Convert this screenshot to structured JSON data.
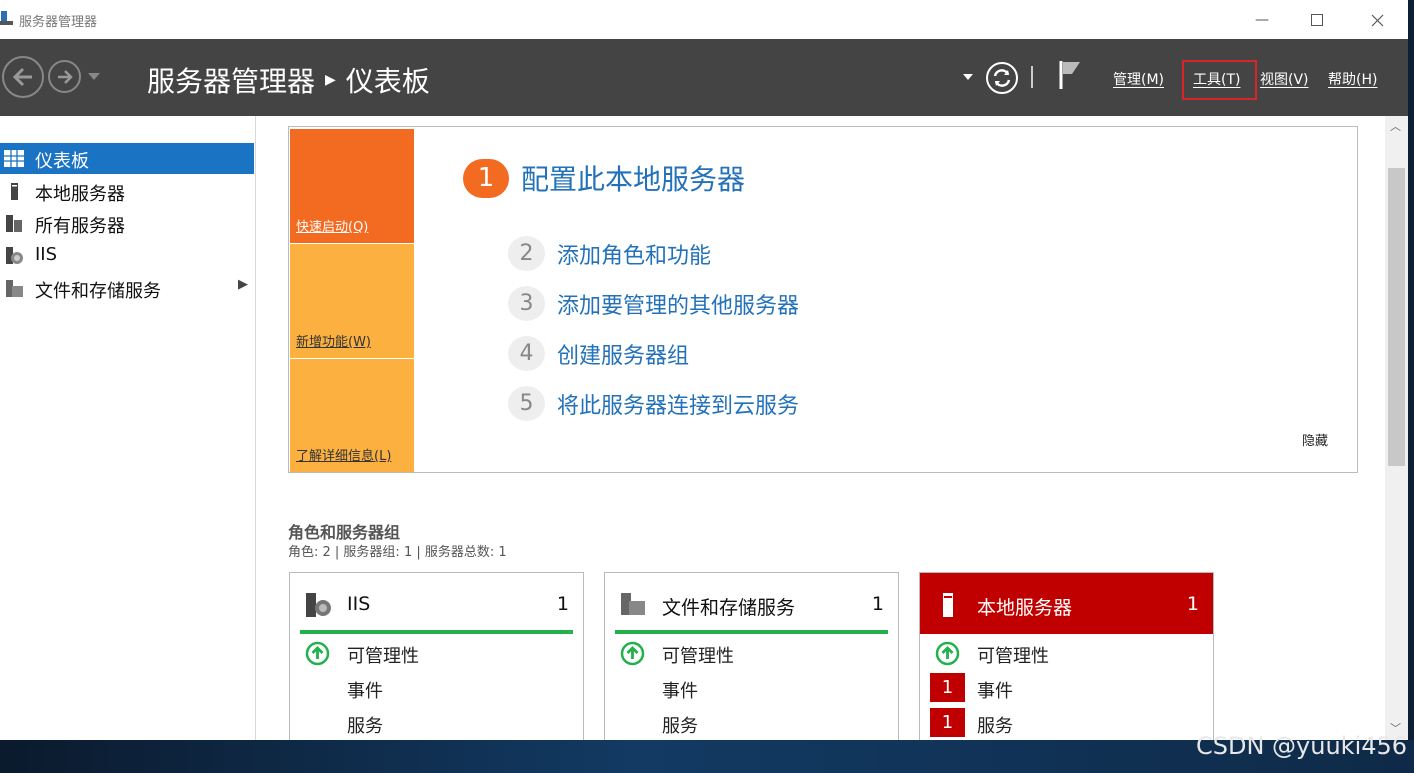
{
  "window": {
    "title": "服务器管理器"
  },
  "header": {
    "breadcrumb_app": "服务器管理器",
    "breadcrumb_page": "仪表板",
    "menus": [
      "管理(M)",
      "工具(T)",
      "视图(V)",
      "帮助(H)"
    ]
  },
  "sidebar": {
    "items": [
      {
        "label": "仪表板",
        "icon": "dashboard-icon",
        "active": true
      },
      {
        "label": "本地服务器",
        "icon": "server-icon"
      },
      {
        "label": "所有服务器",
        "icon": "servers-icon"
      },
      {
        "label": "IIS",
        "icon": "iis-icon"
      },
      {
        "label": "文件和存储服务",
        "icon": "file-storage-icon",
        "expandable": true
      }
    ]
  },
  "welcome": {
    "tiles": [
      "快速启动(Q)",
      "新增功能(W)",
      "了解详细信息(L)"
    ],
    "main_step": {
      "num": "1",
      "text": "配置此本地服务器"
    },
    "steps": [
      {
        "num": "2",
        "text": "添加角色和功能"
      },
      {
        "num": "3",
        "text": "添加要管理的其他服务器"
      },
      {
        "num": "4",
        "text": "创建服务器组"
      },
      {
        "num": "5",
        "text": "将此服务器连接到云服务"
      }
    ],
    "hide": "隐藏"
  },
  "roles": {
    "title": "角色和服务器组",
    "subtitle": "角色: 2 | 服务器组: 1 | 服务器总数: 1",
    "cards": [
      {
        "name": "IIS",
        "count": "1",
        "rows": [
          "可管理性",
          "事件",
          "服务"
        ]
      },
      {
        "name": "文件和存储服务",
        "count": "1",
        "rows": [
          "可管理性",
          "事件",
          "服务"
        ]
      },
      {
        "name": "本地服务器",
        "count": "1",
        "rows": [
          "可管理性",
          "事件",
          "服务"
        ],
        "badges": [
          "1",
          "1"
        ]
      }
    ]
  },
  "watermark": "CSDN @yuuki456",
  "colors": {
    "accent_blue": "#1b73c4",
    "orange": "#f36a21",
    "light_orange": "#fbb040",
    "alert_red": "#c00000",
    "ok_green": "#22b14c"
  }
}
